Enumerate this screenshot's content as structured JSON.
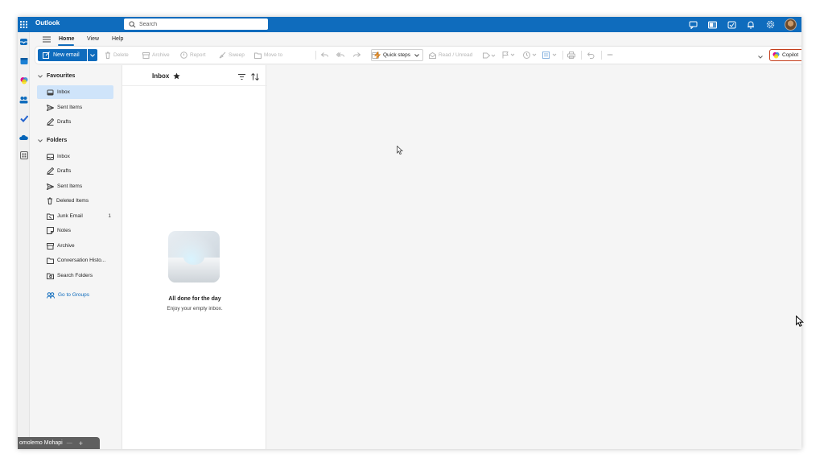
{
  "window": {
    "app_title": "Outlook",
    "search": {
      "placeholder": "Search"
    }
  },
  "colors": {
    "accent": "#0f6cbd",
    "selected_folder_bg": "#cfe4fa",
    "copilot_border": "#c43e1c"
  },
  "ribbon": {
    "tabs": [
      "Home",
      "View",
      "Help"
    ],
    "active_tab": "Home",
    "new_email_label": "New email",
    "actions": {
      "delete": "Delete",
      "archive": "Archive",
      "report": "Report",
      "sweep": "Sweep",
      "move_to": "Move to",
      "quick_steps": "Quick steps",
      "read_unread": "Read / Unread",
      "more": "···"
    },
    "copilot_label": "Copilot"
  },
  "folder_pane": {
    "favourites_label": "Favourites",
    "favourites": [
      {
        "label": "Inbox",
        "icon": "inbox-icon",
        "selected": true
      },
      {
        "label": "Sent Items",
        "icon": "send-icon"
      },
      {
        "label": "Drafts",
        "icon": "pencil-icon"
      }
    ],
    "folders_label": "Folders",
    "folders": [
      {
        "label": "Inbox",
        "icon": "inbox-icon"
      },
      {
        "label": "Drafts",
        "icon": "pencil-icon"
      },
      {
        "label": "Sent Items",
        "icon": "send-icon"
      },
      {
        "label": "Deleted Items",
        "icon": "trash-icon"
      },
      {
        "label": "Junk Email",
        "icon": "junk-icon",
        "count": "1"
      },
      {
        "label": "Notes",
        "icon": "note-icon"
      },
      {
        "label": "Archive",
        "icon": "archive-icon"
      },
      {
        "label": "Conversation Histo...",
        "icon": "folder-icon"
      },
      {
        "label": "Search Folders",
        "icon": "search-folder-icon"
      }
    ],
    "groups_link": "Go to Groups"
  },
  "message_list": {
    "title": "Inbox",
    "empty_title": "All done for the day",
    "empty_subtitle": "Enjoy your empty inbox."
  },
  "taskbar": {
    "label": "omolemo Mohapi"
  }
}
